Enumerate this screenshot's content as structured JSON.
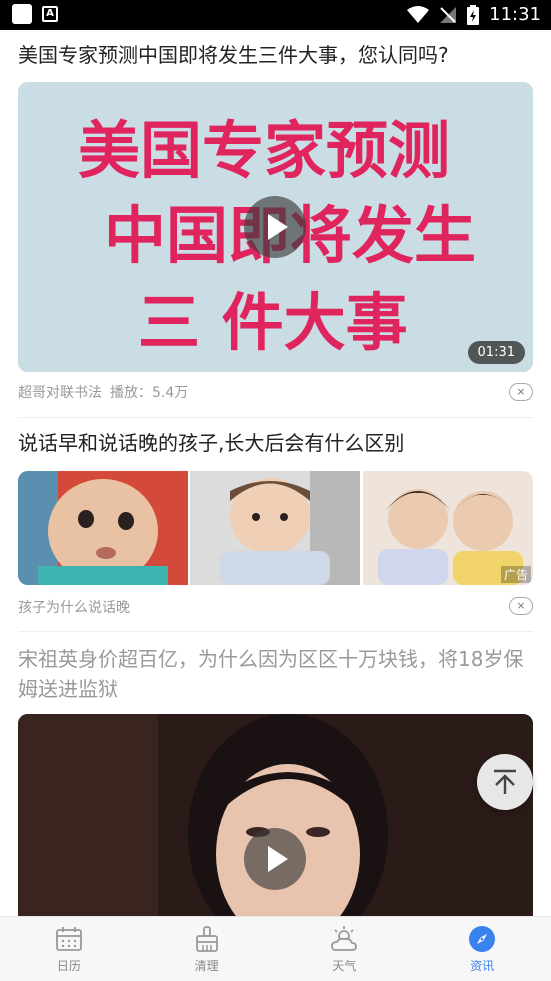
{
  "status_bar": {
    "time": "11:31"
  },
  "articles": [
    {
      "title": "美国专家预测中国即将发生三件大事，您认同吗?",
      "image_text": [
        "美国专家预测",
        "中国即将发生",
        "三 件大事"
      ],
      "duration": "01:31",
      "source": "超哥对联书法",
      "plays": "播放：5.4万",
      "dismiss": "×"
    },
    {
      "title": "说话早和说话晚的孩子,长大后会有什么区别",
      "ad_label": "广告",
      "source": "孩子为什么说话晚",
      "dismiss": "×"
    },
    {
      "title": "宋祖英身价超百亿，为什么因为区区十万块钱，将18岁保姆送进监狱"
    }
  ],
  "bottom_nav": [
    {
      "label": "日历",
      "icon": "calendar-icon"
    },
    {
      "label": "清理",
      "icon": "broom-icon"
    },
    {
      "label": "天气",
      "icon": "weather-icon"
    },
    {
      "label": "资讯",
      "icon": "compass-icon",
      "active": true
    }
  ],
  "colors": {
    "accent": "#3a82f0",
    "calligraphy": "#e0245e",
    "card_bg": "#c9d9e1"
  }
}
